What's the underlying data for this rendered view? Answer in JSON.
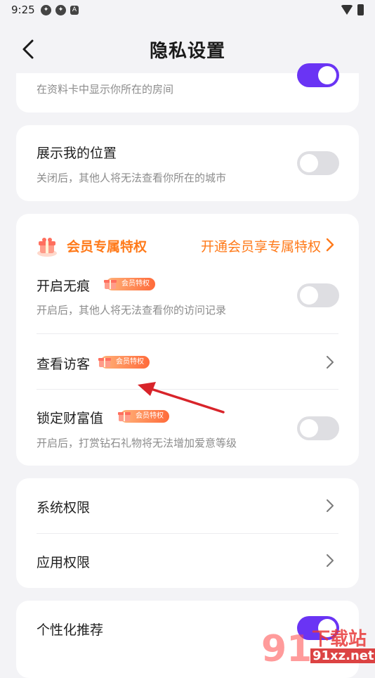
{
  "status_bar": {
    "time": "9:25",
    "icon_3": "A"
  },
  "header": {
    "title": "隐私设置"
  },
  "card_room": {
    "subtitle": "在资料卡中显示你所在的房间",
    "toggle_on": true
  },
  "card_location": {
    "title": "展示我的位置",
    "subtitle": "关闭后，其他人将无法查看你所在的城市",
    "toggle_on": false
  },
  "card_vip": {
    "title": "会员专属特权",
    "link": "开通会员享专属特权",
    "badge_label": "会员特权",
    "rows": [
      {
        "title": "开启无痕",
        "subtitle": "开启后，其他人将无法查看你的访问记录",
        "toggle_on": false
      },
      {
        "title": "查看访客"
      },
      {
        "title": "锁定财富值",
        "subtitle": "开启后，打赏钻石礼物将无法增加爱意等级",
        "toggle_on": false
      }
    ]
  },
  "card_perm": {
    "rows": [
      {
        "title": "系统权限"
      },
      {
        "title": "应用权限"
      }
    ]
  },
  "card_recommend": {
    "title": "个性化推荐",
    "toggle_on": true
  },
  "watermark": {
    "text": "下载站",
    "domain": "91xz.net"
  },
  "colors": {
    "accent": "#6a34f4",
    "vip": "#ff7a1a",
    "background": "#f3f3f6"
  }
}
